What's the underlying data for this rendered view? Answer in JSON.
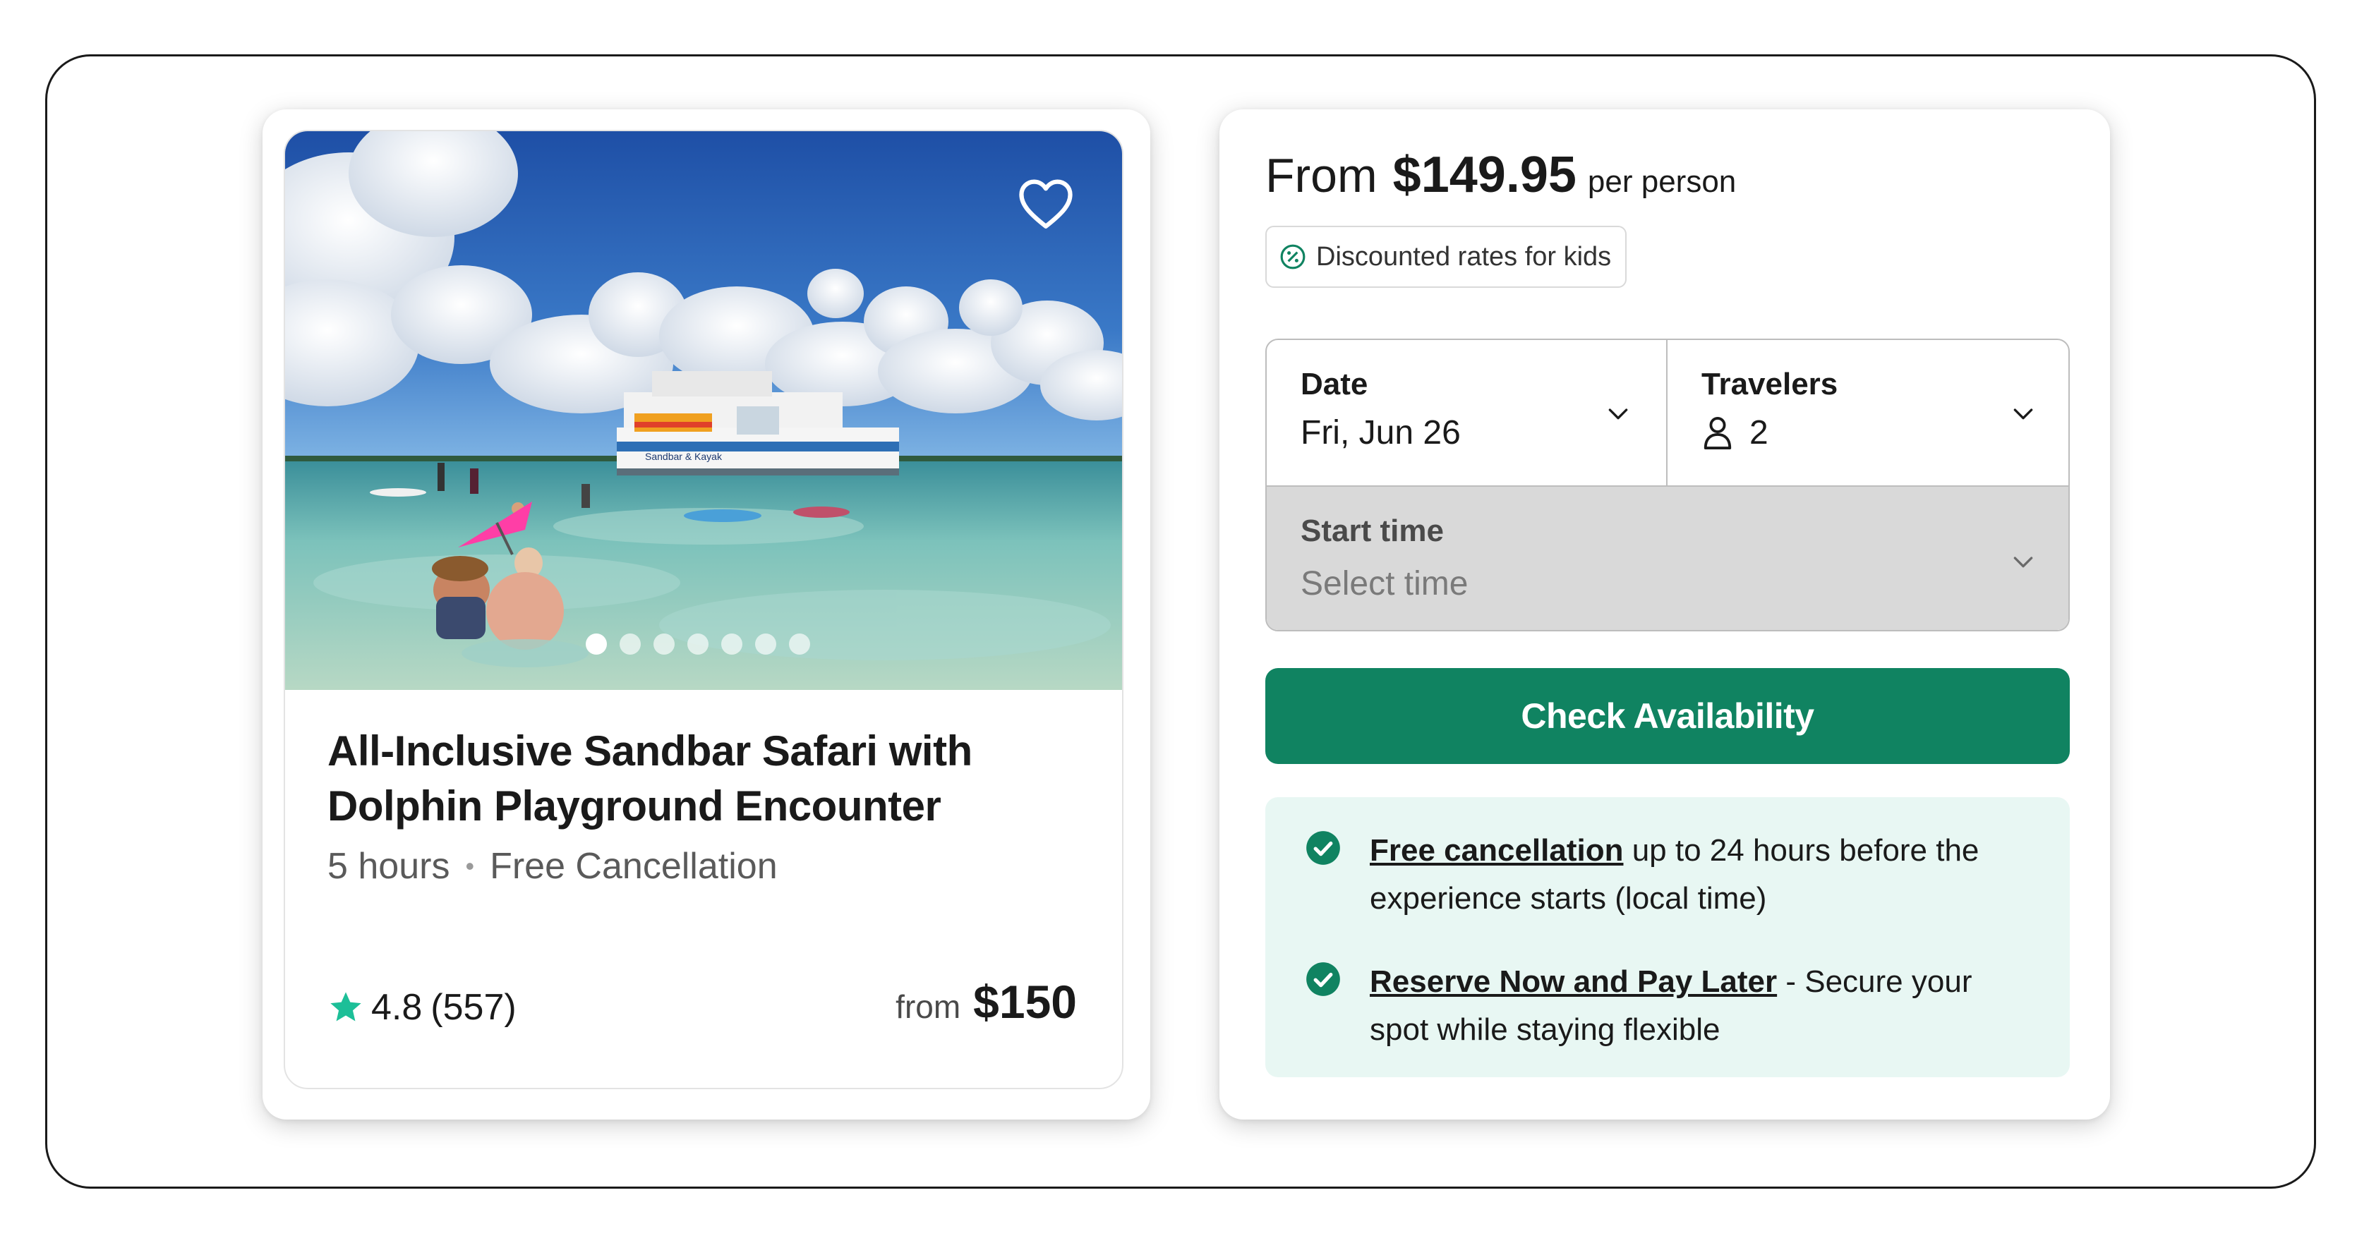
{
  "product": {
    "title": "All-Inclusive Sandbar Safari with Dolphin Playground Encounter",
    "duration": "5 hours",
    "separator": "•",
    "cancellation": "Free Cancellation",
    "rating": "4.8",
    "review_count": "(557)",
    "price_prefix": "from",
    "price": "$150",
    "image_boat_text": "Sandbar & Kayak",
    "carousel": {
      "total": 7,
      "active_index": 0
    }
  },
  "booking": {
    "price_prefix": "From",
    "price": "$149.95",
    "price_suffix": "per person",
    "discount_badge": "Discounted rates for kids",
    "date": {
      "label": "Date",
      "value": "Fri, Jun 26"
    },
    "travelers": {
      "label": "Travelers",
      "value": "2"
    },
    "start_time": {
      "label": "Start time",
      "placeholder": "Select time"
    },
    "check_button": "Check Availability",
    "perks": [
      {
        "link": "Free cancellation",
        "text": " up to 24 hours before the experience starts (local time)"
      },
      {
        "link": "Reserve Now and Pay Later",
        "text": " - Secure your spot while staying flexible"
      }
    ]
  },
  "colors": {
    "accent_green": "#108361",
    "star_green": "#1dbf98",
    "perks_bg": "#e8f7f3",
    "disabled_gray": "#d9d9d9"
  },
  "icons": [
    "heart-icon",
    "star-icon",
    "percent-icon",
    "chevron-down-icon",
    "person-icon",
    "check-circle-icon"
  ]
}
